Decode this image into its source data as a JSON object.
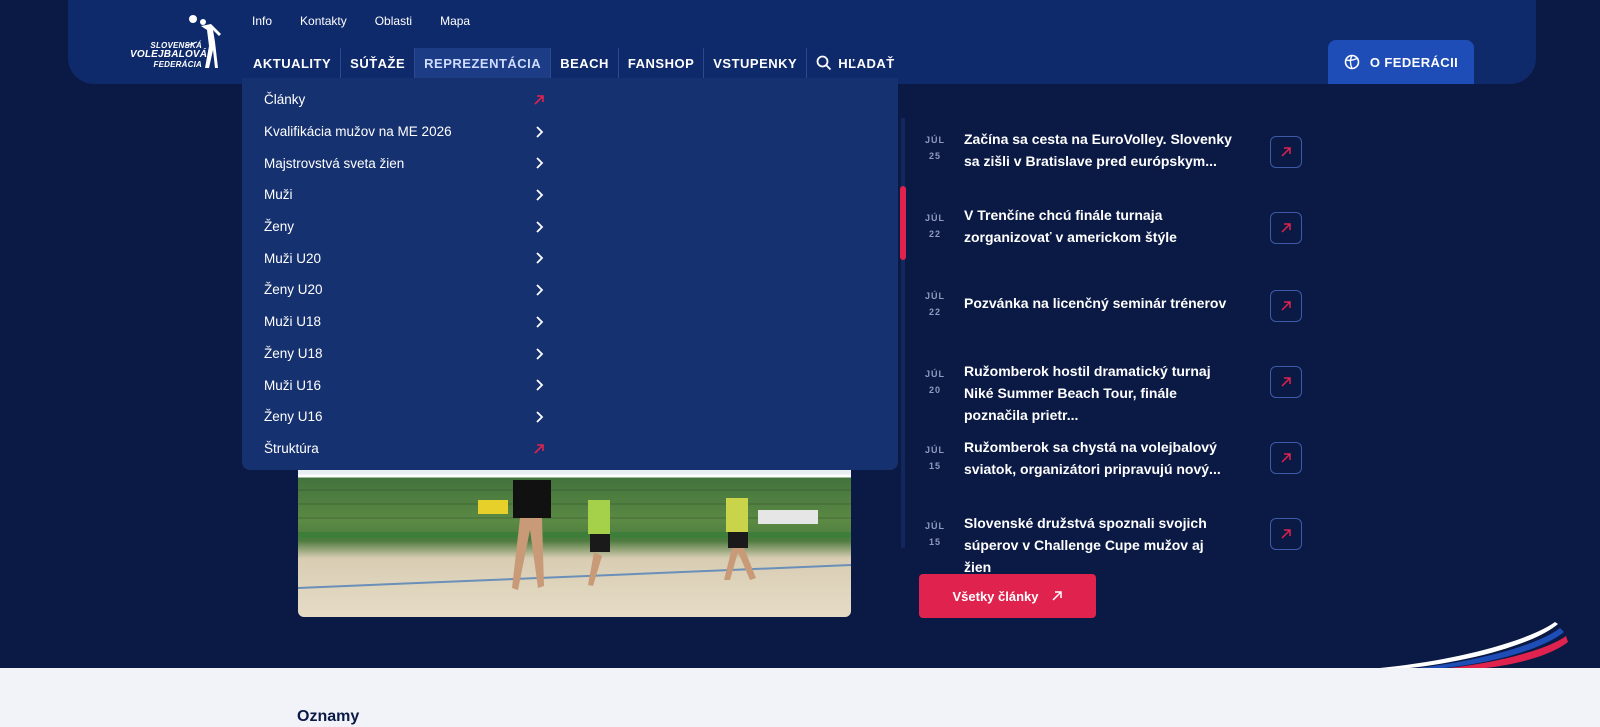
{
  "logo": {
    "line1": "SLOVENSKÁ",
    "line2": "VOLEJBALOVÁ",
    "line3": "FEDERÁCIA"
  },
  "top_links": [
    "Info",
    "Kontakty",
    "Oblasti",
    "Mapa"
  ],
  "nav": {
    "items": [
      "AKTUALITY",
      "SÚŤAŽE",
      "REPREZENTÁCIA",
      "BEACH",
      "FANSHOP",
      "VSTUPENKY"
    ],
    "search_label": "HĽADAŤ",
    "active": "REPREZENTÁCIA"
  },
  "federation_button": "O FEDERÁCII",
  "dropdown": {
    "items": [
      {
        "label": "Články",
        "icon": "external-arrow-icon"
      },
      {
        "label": "Kvalifikácia mužov na ME 2026",
        "icon": "chevron-right-icon"
      },
      {
        "label": "Majstrovstvá sveta žien",
        "icon": "chevron-right-icon"
      },
      {
        "label": "Muži",
        "icon": "chevron-right-icon"
      },
      {
        "label": "Ženy",
        "icon": "chevron-right-icon"
      },
      {
        "label": "Muži U20",
        "icon": "chevron-right-icon"
      },
      {
        "label": "Ženy U20",
        "icon": "chevron-right-icon"
      },
      {
        "label": "Muži U18",
        "icon": "chevron-right-icon"
      },
      {
        "label": "Ženy U18",
        "icon": "chevron-right-icon"
      },
      {
        "label": "Muži U16",
        "icon": "chevron-right-icon"
      },
      {
        "label": "Ženy U16",
        "icon": "chevron-right-icon"
      },
      {
        "label": "Štruktúra",
        "icon": "external-arrow-icon"
      }
    ]
  },
  "news": [
    {
      "month": "JÚL",
      "day": "25",
      "title": "Začína sa cesta na EuroVolley. Slovenky sa zišli v Bratislave pred európskym..."
    },
    {
      "month": "JÚL",
      "day": "22",
      "title": "V Trenčíne chcú finále turnaja zorganizovať v americkom štýle"
    },
    {
      "month": "JÚL",
      "day": "22",
      "title": "Pozvánka na licenčný seminár trénerov"
    },
    {
      "month": "JÚL",
      "day": "20",
      "title": "Ružomberok hostil dramatický turnaj Niké Summer Beach Tour, finále poznačila prietr..."
    },
    {
      "month": "JÚL",
      "day": "15",
      "title": "Ružomberok sa chystá na volejbalový sviatok, organizátori pripravujú nový..."
    },
    {
      "month": "JÚL",
      "day": "15",
      "title": "Slovenské družstvá spoznali svojich súperov v Challenge Cupe mužov aj žien"
    }
  ],
  "all_articles_button": "Všetky články",
  "lower_section_title": "Oznamy",
  "colors": {
    "navy": "#0b1a45",
    "header": "#0f2a6b",
    "accent": "#e0234e",
    "blue": "#1e4db7"
  }
}
